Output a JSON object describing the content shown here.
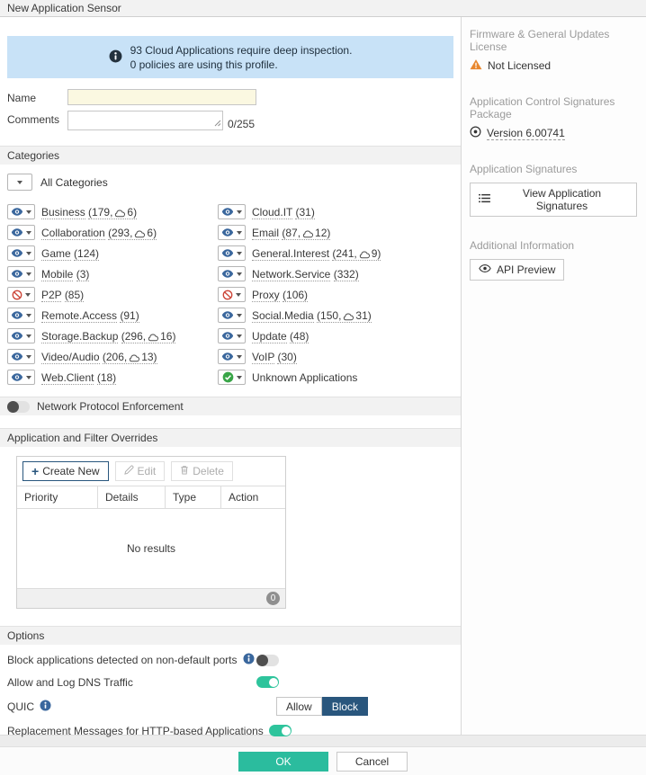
{
  "window": {
    "title": "New Application Sensor"
  },
  "banner": {
    "icon": "info-icon",
    "line1": "93 Cloud Applications require deep inspection.",
    "line2": "0 policies are using this profile."
  },
  "form": {
    "name_label": "Name",
    "name_value": "",
    "comments_label": "Comments",
    "comments_value": "",
    "comments_counter": "0/255"
  },
  "categories": {
    "section_title": "Categories",
    "filter_selected": "All Categories",
    "left": [
      {
        "name": "Business",
        "count": "179",
        "cloud": "6",
        "action": "monitor"
      },
      {
        "name": "Collaboration",
        "count": "293",
        "cloud": "6",
        "action": "monitor"
      },
      {
        "name": "Game",
        "count": "124",
        "cloud": null,
        "action": "monitor"
      },
      {
        "name": "Mobile",
        "count": "3",
        "cloud": null,
        "action": "monitor"
      },
      {
        "name": "P2P",
        "count": "85",
        "cloud": null,
        "action": "block"
      },
      {
        "name": "Remote.Access",
        "count": "91",
        "cloud": null,
        "action": "monitor"
      },
      {
        "name": "Storage.Backup",
        "count": "296",
        "cloud": "16",
        "action": "monitor"
      },
      {
        "name": "Video/Audio",
        "count": "206",
        "cloud": "13",
        "action": "monitor"
      },
      {
        "name": "Web.Client",
        "count": "18",
        "cloud": null,
        "action": "monitor"
      }
    ],
    "right": [
      {
        "name": "Cloud.IT",
        "count": "31",
        "cloud": null,
        "action": "monitor"
      },
      {
        "name": "Email",
        "count": "87",
        "cloud": "12",
        "action": "monitor"
      },
      {
        "name": "General.Interest",
        "count": "241",
        "cloud": "9",
        "action": "monitor"
      },
      {
        "name": "Network.Service",
        "count": "332",
        "cloud": null,
        "action": "monitor"
      },
      {
        "name": "Proxy",
        "count": "106",
        "cloud": null,
        "action": "block"
      },
      {
        "name": "Social.Media",
        "count": "150",
        "cloud": "31",
        "action": "monitor"
      },
      {
        "name": "Update",
        "count": "48",
        "cloud": null,
        "action": "monitor"
      },
      {
        "name": "VoIP",
        "count": "30",
        "cloud": null,
        "action": "monitor"
      },
      {
        "name": "Unknown Applications",
        "count": null,
        "cloud": null,
        "action": "allow"
      }
    ]
  },
  "network_protocol": {
    "label": "Network Protocol Enforcement",
    "enabled": false
  },
  "overrides": {
    "section_title": "Application and Filter Overrides",
    "toolbar": {
      "create": "Create New",
      "edit": "Edit",
      "delete": "Delete"
    },
    "table": {
      "headers": [
        "Priority",
        "Details",
        "Type",
        "Action"
      ],
      "empty_text": "No results",
      "footer_count": "0"
    }
  },
  "options": {
    "section_title": "Options",
    "block_non_default": {
      "label": "Block applications detected on non-default ports",
      "enabled": false
    },
    "dns": {
      "label": "Allow and Log DNS Traffic",
      "enabled": true
    },
    "quic": {
      "label": "QUIC",
      "allow_label": "Allow",
      "block_label": "Block",
      "selected": "Block"
    },
    "replacement": {
      "label": "Replacement Messages for HTTP-based Applications",
      "enabled": true
    }
  },
  "sidebar": {
    "firmware": {
      "heading": "Firmware & General Updates License",
      "status": "Not Licensed"
    },
    "signatures_package": {
      "heading": "Application Control Signatures Package",
      "version": "Version 6.00741"
    },
    "app_signatures": {
      "heading": "Application Signatures",
      "button": "View Application Signatures"
    },
    "additional": {
      "heading": "Additional Information",
      "button": "API Preview"
    }
  },
  "footer": {
    "ok": "OK",
    "cancel": "Cancel"
  },
  "colors": {
    "accent_teal": "#2bbc9e",
    "accent_navy": "#29567d",
    "info_blue": "#3a679d",
    "eye_blue": "#3a679d",
    "block_red": "#cc4437",
    "allow_green": "#38a547",
    "warning_orange": "#e8872e",
    "banner_bg": "#c8e2f7",
    "input_bg": "#fbf8e1"
  }
}
